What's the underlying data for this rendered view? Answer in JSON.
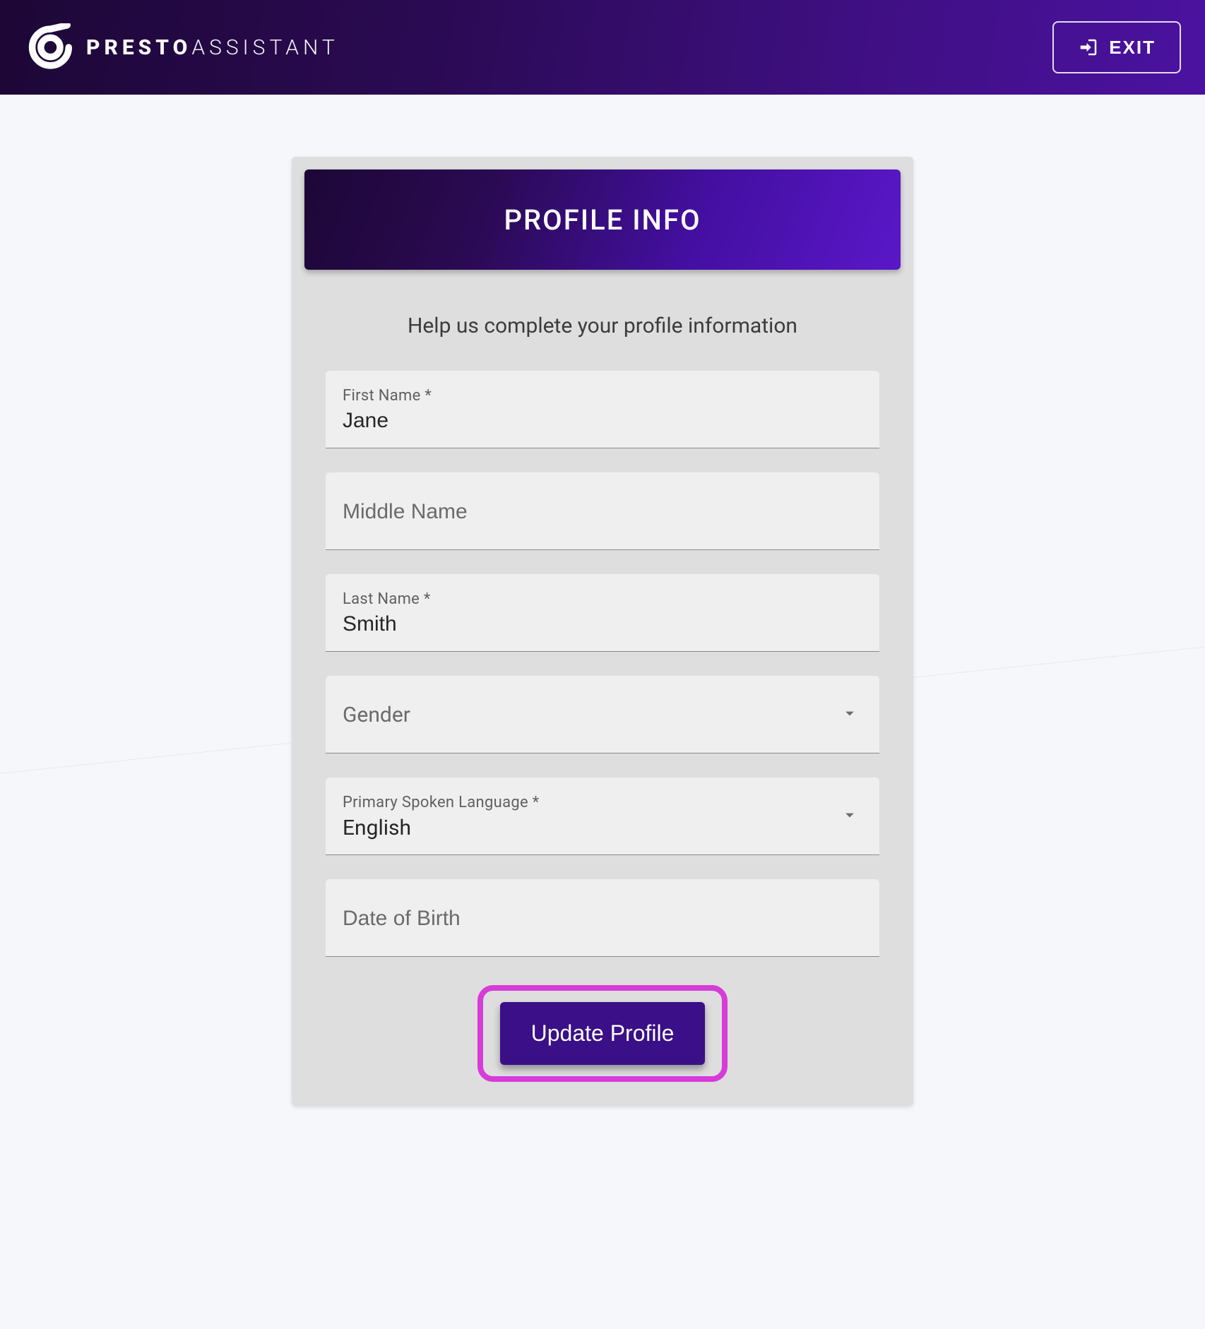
{
  "header": {
    "brand_strong": "PRESTO",
    "brand_light": "ASSISTANT",
    "exit_label": "EXIT"
  },
  "card": {
    "title": "PROFILE INFO",
    "subtitle": "Help us complete your profile information",
    "submit_label": "Update Profile"
  },
  "fields": {
    "first_name": {
      "label": "First Name *",
      "value": "Jane"
    },
    "middle_name": {
      "placeholder": "Middle Name",
      "value": ""
    },
    "last_name": {
      "label": "Last Name *",
      "value": "Smith"
    },
    "gender": {
      "placeholder": "Gender",
      "value": ""
    },
    "language": {
      "label": "Primary Spoken Language *",
      "value": "English"
    },
    "dob": {
      "placeholder": "Date of Birth",
      "value": ""
    }
  }
}
